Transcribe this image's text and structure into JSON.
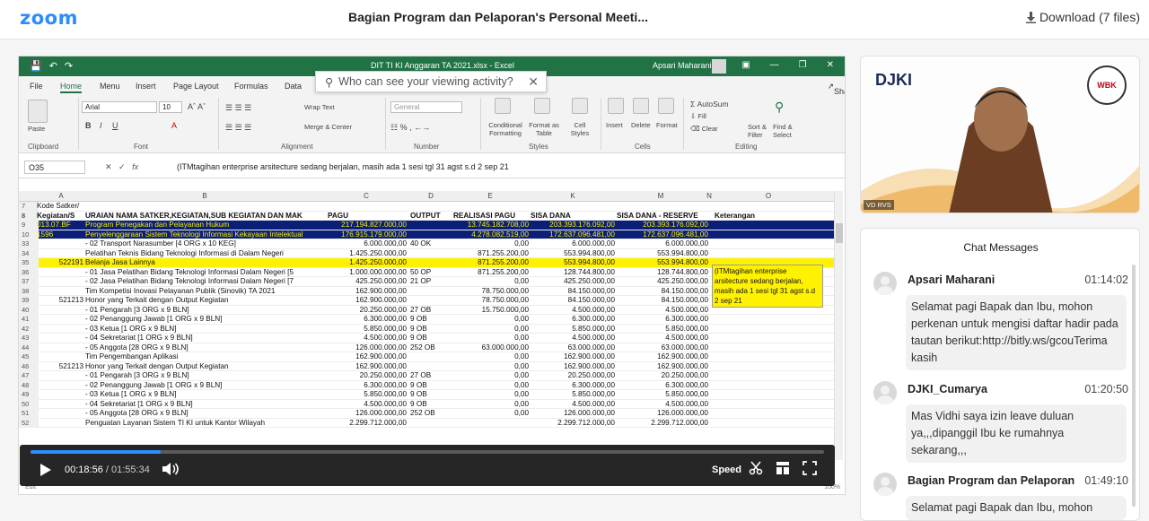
{
  "app": {
    "logo": "zoom",
    "title": "Bagian Program dan Pelaporan's Personal Meeti...",
    "download_label": "Download (7 files)"
  },
  "excel": {
    "file_title": "DIT TI KI Anggaran TA 2021.xlsx  -  Excel",
    "user": "Apsari Maharani",
    "tabs": [
      "File",
      "Home",
      "Menu",
      "Insert",
      "Page Layout",
      "Formulas",
      "Data"
    ],
    "share": "Share",
    "ribbon": {
      "paste": "Paste",
      "font_name": "Arial",
      "font_size": "10",
      "wrap": "Wrap Text",
      "merge": "Merge & Center",
      "number_format": "General",
      "cond": "Conditional Formatting",
      "format_table": "Format as Table",
      "cell_styles": "Cell Styles",
      "insert": "Insert",
      "delete": "Delete",
      "format": "Format",
      "autosum": "AutoSum",
      "fill": "Fill",
      "clear": "Clear",
      "sort": "Sort & Filter",
      "find": "Find & Select",
      "groups": [
        "Clipboard",
        "Font",
        "Alignment",
        "Number",
        "Styles",
        "Cells",
        "Editing"
      ]
    },
    "popup": {
      "text": "Who can see your viewing activity?"
    },
    "name_box": "O35",
    "formula": "(ITMtagihan enterprise arsitecture sedang berjalan, masih ada 1 sesi tgl 31 agst s.d 2 sep 21",
    "columns": [
      "A",
      "B",
      "C",
      "D",
      "E",
      "K",
      "M",
      "N",
      "O"
    ],
    "row7": {
      "rn": "7",
      "a": "Kode Satker/"
    },
    "header": {
      "rn": "8",
      "a": "Kegiatan/S",
      "b": "URAIAN NAMA SATKER,KEGIATAN,SUB KEGIATAN DAN MAK",
      "c": "PAGU",
      "d": "OUTPUT",
      "e": "REALISASI PAGU",
      "k": "SISA DANA",
      "m": "SISA DANA - RESERVE",
      "o": "Keterangan"
    },
    "rows": [
      {
        "rn": "9",
        "style": "blue",
        "a": "013.07.BF",
        "b": "Program Penegakan dan Pelayanan Hukum",
        "c": "217.194.827.000,00",
        "d": "",
        "e": "13.745.182.708,00",
        "k": "203.393.176.092,00",
        "m": "203.393.176.092,00"
      },
      {
        "rn": "10",
        "style": "blue",
        "a": "1596",
        "b": "Penyelenggaraan Sistem Teknologi Informasi Kekayaan Intelektual",
        "c": "176.915.179.000,00",
        "d": "",
        "e": "4.278.082.519,00",
        "k": "172.637.096.481,00",
        "m": "172.637.096.481,00"
      },
      {
        "rn": "33",
        "style": "",
        "a": "",
        "b": "- 02 Transport Narasumber [4 ORG x 10 KEG]",
        "c": "6.000.000,00",
        "d": "40 OK",
        "e": "0,00",
        "k": "6.000.000,00",
        "m": "6.000.000,00"
      },
      {
        "rn": "34",
        "style": "",
        "a": "",
        "b": "Pelatihan Teknis Bidang Teknologi Informasi di Dalam Negeri",
        "c": "1.425.250.000,00",
        "d": "",
        "e": "871.255.200,00",
        "k": "553.994.800,00",
        "m": "553.994.800,00"
      },
      {
        "rn": "35",
        "style": "yellow",
        "a": "522191",
        "b": "Belanja Jasa Lainnya",
        "c": "1.425.250.000,00",
        "d": "",
        "e": "871.255.200,00",
        "k": "553.994.800,00",
        "m": "553.994.800,00"
      },
      {
        "rn": "36",
        "style": "",
        "a": "",
        "b": "- 01 Jasa Pelatihan Bidang Teknologi Informasi Dalam Negeri [5",
        "c": "1.000.000.000,00",
        "d": "50 OP",
        "e": "871.255.200,00",
        "k": "128.744.800,00",
        "m": "128.744.800,00"
      },
      {
        "rn": "37",
        "style": "",
        "a": "",
        "b": "- 02 Jasa Pelatihan Bidang Teknologi Informasi Dalam Negeri [7",
        "c": "425.250.000,00",
        "d": "21 OP",
        "e": "0,00",
        "k": "425.250.000,00",
        "m": "425.250.000,00"
      },
      {
        "rn": "38",
        "style": "",
        "a": "",
        "b": "Tim Kompetisi Inovasi Pelayanan Publik (Sinovik) TA 2021",
        "c": "162.900.000,00",
        "d": "",
        "e": "78.750.000,00",
        "k": "84.150.000,00",
        "m": "84.150.000,00"
      },
      {
        "rn": "39",
        "style": "",
        "a": "521213",
        "b": "Honor yang Terkait dengan Output Kegiatan",
        "c": "162.900.000,00",
        "d": "",
        "e": "78.750.000,00",
        "k": "84.150.000,00",
        "m": "84.150.000,00"
      },
      {
        "rn": "40",
        "style": "",
        "a": "",
        "b": "- 01 Pengarah [3 ORG x 9 BLN]",
        "c": "20.250.000,00",
        "d": "27 OB",
        "e": "15.750.000,00",
        "k": "4.500.000,00",
        "m": "4.500.000,00"
      },
      {
        "rn": "41",
        "style": "",
        "a": "",
        "b": "- 02 Penanggung Jawab [1 ORG x 9 BLN]",
        "c": "6.300.000,00",
        "d": "9 OB",
        "e": "0,00",
        "k": "6.300.000,00",
        "m": "6.300.000,00"
      },
      {
        "rn": "42",
        "style": "",
        "a": "",
        "b": "- 03 Ketua [1 ORG x 9 BLN]",
        "c": "5.850.000,00",
        "d": "9 OB",
        "e": "0,00",
        "k": "5.850.000,00",
        "m": "5.850.000,00"
      },
      {
        "rn": "43",
        "style": "",
        "a": "",
        "b": "- 04 Sekretariat [1 ORG x 9 BLN]",
        "c": "4.500.000,00",
        "d": "9 OB",
        "e": "0,00",
        "k": "4.500.000,00",
        "m": "4.500.000,00"
      },
      {
        "rn": "44",
        "style": "",
        "a": "",
        "b": "- 05 Anggota [28 ORG x 9 BLN]",
        "c": "126.000.000,00",
        "d": "252 OB",
        "e": "63.000.000,00",
        "k": "63.000.000,00",
        "m": "63.000.000,00"
      },
      {
        "rn": "45",
        "style": "",
        "a": "",
        "b": "Tim Pengembangan Aplikasi",
        "c": "162.900.000,00",
        "d": "",
        "e": "0,00",
        "k": "162.900.000,00",
        "m": "162.900.000,00"
      },
      {
        "rn": "46",
        "style": "",
        "a": "521213",
        "b": "Honor yang Terkait dengan Output Kegiatan",
        "c": "162.900.000,00",
        "d": "",
        "e": "0,00",
        "k": "162.900.000,00",
        "m": "162.900.000,00"
      },
      {
        "rn": "47",
        "style": "",
        "a": "",
        "b": "- 01 Pengarah [3 ORG x 9 BLN]",
        "c": "20.250.000,00",
        "d": "27 OB",
        "e": "0,00",
        "k": "20.250.000,00",
        "m": "20.250.000,00"
      },
      {
        "rn": "48",
        "style": "",
        "a": "",
        "b": "- 02 Penanggung Jawab [1 ORG x 9 BLN]",
        "c": "6.300.000,00",
        "d": "9 OB",
        "e": "0,00",
        "k": "6.300.000,00",
        "m": "6.300.000,00"
      },
      {
        "rn": "49",
        "style": "",
        "a": "",
        "b": "- 03 Ketua [1 ORG x 9 BLN]",
        "c": "5.850.000,00",
        "d": "9 OB",
        "e": "0,00",
        "k": "5.850.000,00",
        "m": "5.850.000,00"
      },
      {
        "rn": "50",
        "style": "",
        "a": "",
        "b": "- 04 Sekretariat [1 ORG x 9 BLN]",
        "c": "4.500.000,00",
        "d": "9 OB",
        "e": "0,00",
        "k": "4.500.000,00",
        "m": "4.500.000,00"
      },
      {
        "rn": "51",
        "style": "",
        "a": "",
        "b": "- 05 Anggota [28 ORG x 9 BLN]",
        "c": "126.000.000,00",
        "d": "252 OB",
        "e": "0,00",
        "k": "126.000.000,00",
        "m": "126.000.000,00"
      },
      {
        "rn": "52",
        "style": "",
        "a": "",
        "b": "Penguatan Layanan Sistem TI KI untuk Kantor Wilayah",
        "c": "2.299.712.000,00",
        "d": "",
        "e": "",
        "k": "2.299.712.000,00",
        "m": "2.299.712.000,00"
      }
    ],
    "note": "(ITMtagihan enterprise arsitecture sedang berjalan, masih ada 1 sesi tgl 31 agst s.d 2 sep 21",
    "status": "Edit",
    "zoom": "100%"
  },
  "player": {
    "current_time": "00:18:56",
    "duration": "/ 01:55:34",
    "speed_label": "Speed",
    "progress": 0.164
  },
  "speaker": {
    "name": "VD RVS",
    "logo_text": "DJKI",
    "badge": "WBK"
  },
  "chat": {
    "title": "Chat Messages",
    "messages": [
      {
        "sender": "Apsari Maharani",
        "time": "01:14:02",
        "text": "Selamat pagi Bapak dan Ibu, mohon perkenan untuk mengisi daftar hadir pada tautan berikut:http://bitly.ws/gcouTerima kasih"
      },
      {
        "sender": "DJKI_Cumarya",
        "time": "01:20:50",
        "text": "Mas Vidhi saya izin leave duluan ya,,,dipanggil Ibu ke rumahnya sekarang,,,"
      },
      {
        "sender": "Bagian Program dan Pelaporan",
        "time": "01:49:10",
        "text": "Selamat pagi Bapak dan Ibu, mohon"
      }
    ]
  },
  "colors": {
    "zoom_blue": "#2d8cff",
    "excel_green": "#217346",
    "row_blue": "#0b1e78",
    "row_yellow": "#fff200"
  }
}
